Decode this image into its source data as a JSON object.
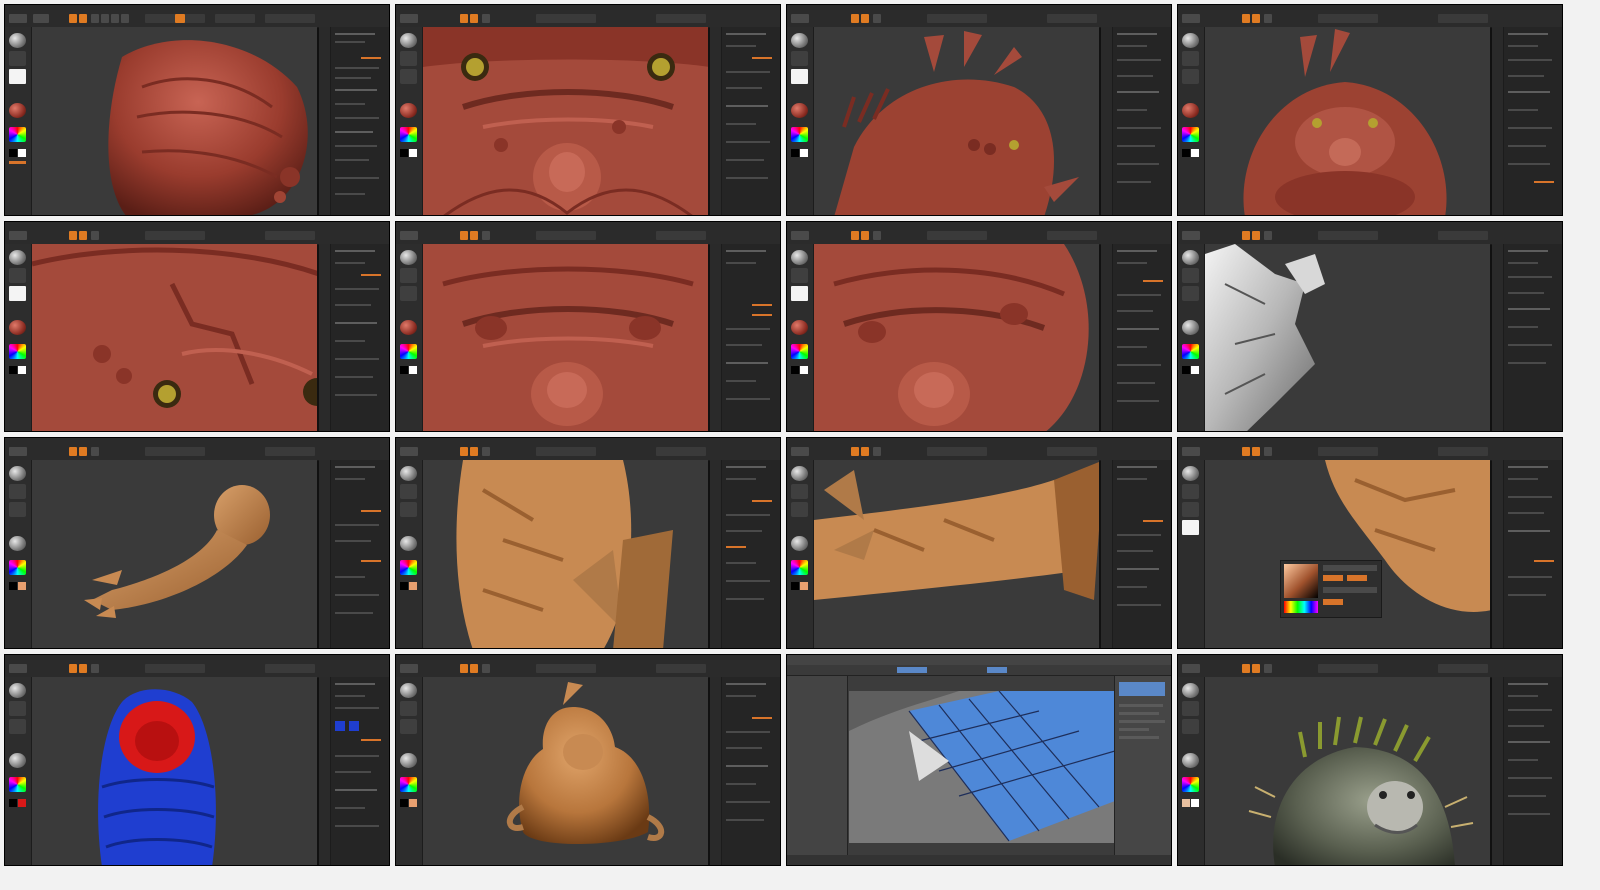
{
  "sheet": {
    "background": "#f2f2f2",
    "columns": 4,
    "rows": 4
  },
  "colors": {
    "accent": "#e07b22",
    "clay_red": "#a44a3b",
    "clay_orange": "#c88a52",
    "viewport_bg": "#3a3a3a",
    "mask_blue": "#1f3ed0",
    "mask_red": "#d81818",
    "uv_blue": "#4e88d8"
  },
  "frames": [
    {
      "id": "f1",
      "app": "zbrush",
      "subject": "head-top-clay",
      "material": "clay-red",
      "watermark": ""
    },
    {
      "id": "f2",
      "app": "zbrush",
      "subject": "face-closeup-eyes",
      "material": "clay-red",
      "watermark": ""
    },
    {
      "id": "f3",
      "app": "zbrush",
      "subject": "side-view-spikes",
      "material": "clay-red",
      "watermark": ""
    },
    {
      "id": "f4",
      "app": "zbrush",
      "subject": "full-bust-front",
      "material": "clay-red",
      "watermark": ""
    },
    {
      "id": "f5",
      "app": "zbrush",
      "subject": "eye-closeup",
      "material": "clay-red",
      "watermark": ""
    },
    {
      "id": "f6",
      "app": "zbrush",
      "subject": "mouth-closeup",
      "material": "clay-red",
      "watermark": ""
    },
    {
      "id": "f7",
      "app": "zbrush",
      "subject": "mouth-closeup-angle",
      "material": "clay-red",
      "watermark": ""
    },
    {
      "id": "f8",
      "app": "zbrush",
      "subject": "fabric-cloth-white",
      "material": "white",
      "watermark": ""
    },
    {
      "id": "f9",
      "app": "zbrush",
      "subject": "arm-sculpt",
      "material": "clay-orange",
      "watermark": ""
    },
    {
      "id": "f10",
      "app": "zbrush",
      "subject": "arm-closeup",
      "material": "clay-orange",
      "watermark": ""
    },
    {
      "id": "f11",
      "app": "zbrush",
      "subject": "arm-fins",
      "material": "clay-orange",
      "watermark": ""
    },
    {
      "id": "f12",
      "app": "zbrush",
      "subject": "shoulder-color-picker",
      "material": "clay-orange",
      "watermark": ""
    },
    {
      "id": "f13",
      "app": "zbrush",
      "subject": "polygroups-blue-red",
      "material": "polypaint",
      "watermark": ""
    },
    {
      "id": "f14",
      "app": "zbrush",
      "subject": "full-body-orange",
      "material": "clay-orange",
      "watermark": ""
    },
    {
      "id": "f15",
      "app": "maya",
      "subject": "uv-layout",
      "material": "blue-uv",
      "watermark": ""
    },
    {
      "id": "f16",
      "app": "zbrush",
      "subject": "final-textured-creature",
      "material": "painted",
      "watermark": ""
    }
  ]
}
